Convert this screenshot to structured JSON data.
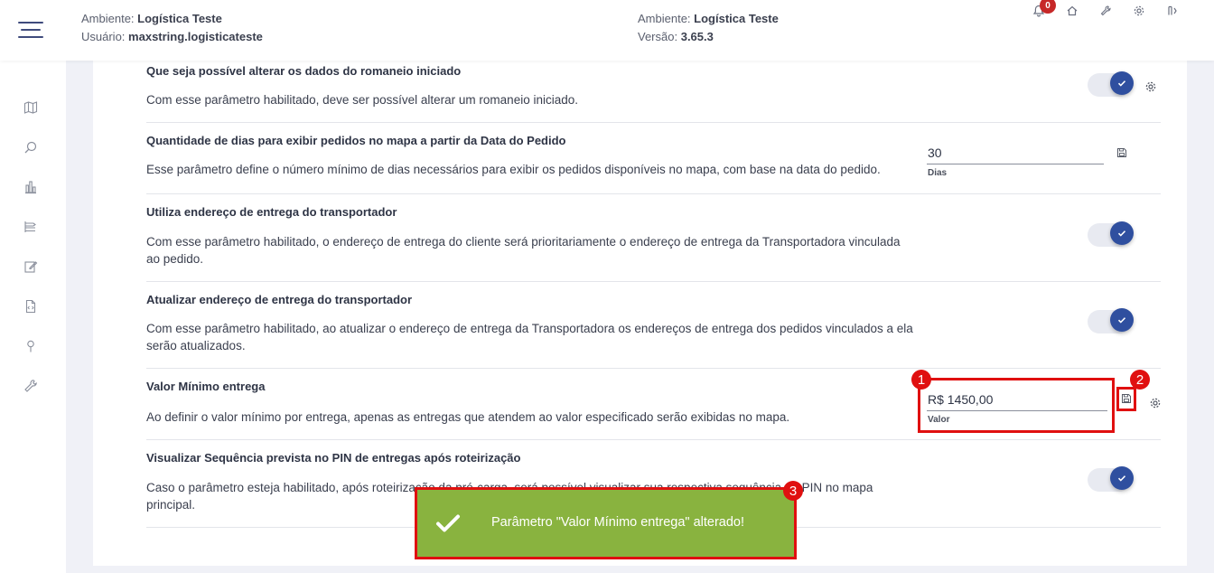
{
  "header": {
    "env_label_left": "Ambiente:",
    "env_value_left": "Logística Teste",
    "user_label": "Usuário:",
    "user_value": "maxstring.logisticateste",
    "env_label_mid": "Ambiente:",
    "env_value_mid": "Logística Teste",
    "version_label": "Versão:",
    "version_value": "3.65.3",
    "notification_count": "0",
    "icons": [
      "bell-icon",
      "home-icon",
      "wrench-icon",
      "gear-icon",
      "logout-icon"
    ]
  },
  "sidebar": {
    "icons": [
      "map-icon",
      "search-icon",
      "chart-icon",
      "list-icon",
      "edit-icon",
      "document-icon",
      "pin-icon",
      "tools-icon"
    ]
  },
  "params": [
    {
      "title": "Que seja possível alterar os dados do romaneio iniciado",
      "desc": "Com esse parâmetro habilitado, deve ser possível alterar um romaneio iniciado.",
      "control": "toggle",
      "enabled": true
    },
    {
      "title": "Quantidade de dias para exibir pedidos no mapa a partir da Data do Pedido",
      "desc": "Esse parâmetro define o número mínimo de dias necessários para exibir os pedidos disponíveis no mapa, com base na data do pedido.",
      "control": "input",
      "value": "30",
      "field_label": "Dias"
    },
    {
      "title": "Utiliza endereço de entrega do transportador",
      "desc": "Com esse parâmetro habilitado, o endereço de entrega do cliente será prioritariamente o endereço de entrega da Transportadora vinculada ao pedido.",
      "control": "toggle",
      "enabled": true
    },
    {
      "title": "Atualizar endereço de entrega do transportador",
      "desc": "Com esse parâmetro habilitado, ao atualizar o endereço de entrega da Transportadora os endereços de entrega dos pedidos vinculados a ela serão atualizados.",
      "control": "toggle",
      "enabled": true
    },
    {
      "title": "Valor Mínimo entrega",
      "desc": "Ao definir o valor mínimo por entrega, apenas as entregas que atendem ao valor especificado serão exibidas no mapa.",
      "control": "input",
      "value": "R$ 1450,00",
      "field_label": "Valor"
    },
    {
      "title": "Visualizar Sequência prevista no PIN de entregas após roteirização",
      "desc": "Caso o parâmetro esteja habilitado, após roteirização da pré-carga, será possível visualizar sua respectiva sequência no PIN no mapa principal.",
      "control": "toggle",
      "enabled": true
    }
  ],
  "annotations": {
    "markers": [
      "1",
      "2",
      "3"
    ],
    "highlight_color": "#e01010"
  },
  "toast": {
    "message": "Parâmetro \"Valor Mínimo entrega\" alterado!",
    "color": "#89b33f",
    "icon": "check-icon"
  },
  "colors": {
    "toggle_knob": "#2f4f9f",
    "toggle_track": "#e8eaf1",
    "menu": "#3f4b7c"
  }
}
